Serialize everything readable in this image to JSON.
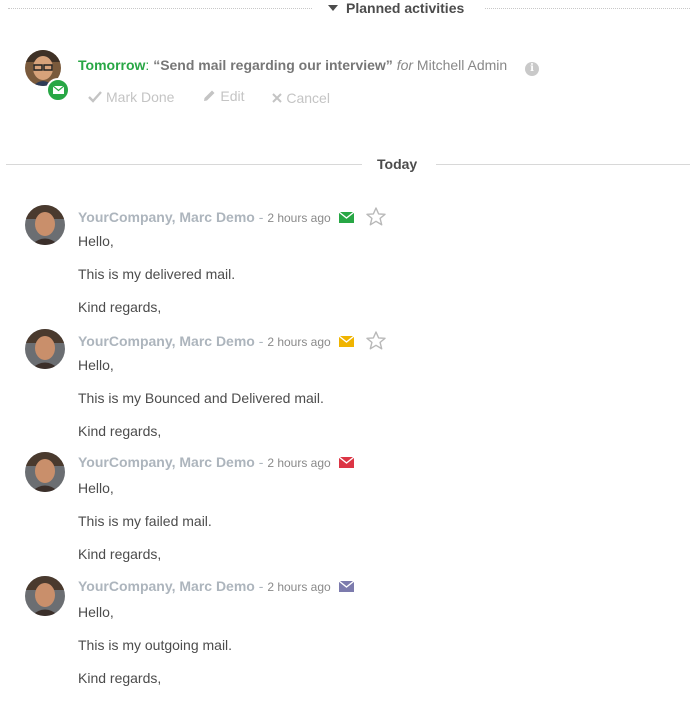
{
  "planned": {
    "title": "Planned activities"
  },
  "activity": {
    "when": "Tomorrow",
    "colon": ":",
    "summary": "“Send mail regarding our interview”",
    "for_label": "for",
    "assignee": "Mitchell Admin",
    "actions": {
      "mark_done": "Mark Done",
      "edit": "Edit",
      "cancel": "Cancel"
    },
    "badge_color": "#28a745"
  },
  "today_label": "Today",
  "messages": [
    {
      "author": "YourCompany, Marc Demo",
      "date": "2 hours ago",
      "status": "delivered",
      "status_color": "#28a745",
      "starred": false,
      "lines": [
        "Hello,",
        "This is my delivered mail.",
        "Kind regards,"
      ]
    },
    {
      "author": "YourCompany, Marc Demo",
      "date": "2 hours ago",
      "status": "bounced",
      "status_color": "#f0b400",
      "starred": false,
      "lines": [
        "Hello,",
        "This is my Bounced and Delivered mail.",
        "Kind regards,"
      ]
    },
    {
      "author": "YourCompany, Marc Demo",
      "date": "2 hours ago",
      "status": "failed",
      "status_color": "#dc3545",
      "lines": [
        "Hello,",
        "This is my failed mail.",
        "Kind regards,"
      ]
    },
    {
      "author": "YourCompany, Marc Demo",
      "date": "2 hours ago",
      "status": "outgoing",
      "status_color": "#7c7bad",
      "lines": [
        "Hello,",
        "This is my outgoing mail.",
        "Kind regards,"
      ]
    }
  ]
}
